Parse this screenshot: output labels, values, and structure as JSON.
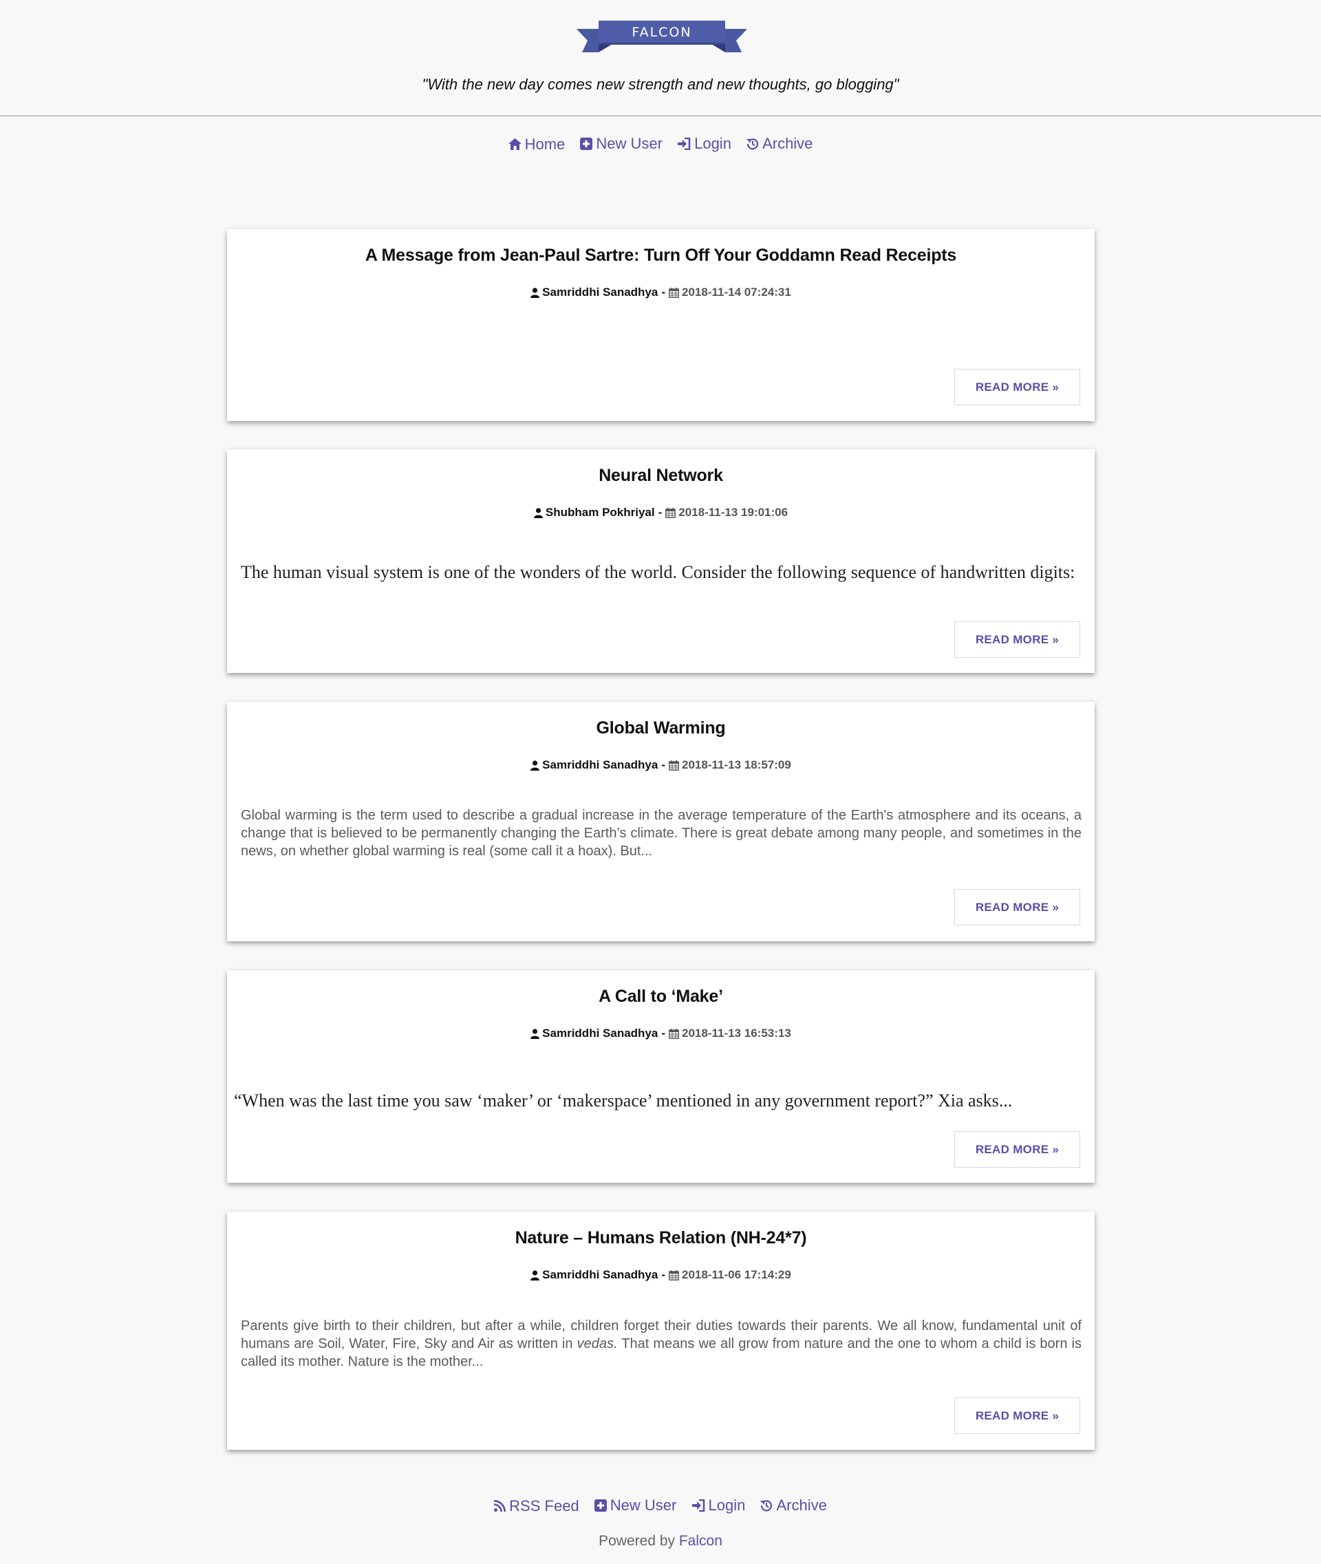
{
  "colors": {
    "accent": "#5a4ea8",
    "ribbon": "#4a58a0",
    "ribbon_dark": "#2f3a78",
    "page_bg": "#f8f8f8"
  },
  "header": {
    "logo_text": "FALCON",
    "tagline": "\"With the new day comes new strength and new thoughts, go blogging\""
  },
  "nav": {
    "items": [
      {
        "label": "Home",
        "icon": "home-icon"
      },
      {
        "label": "New User",
        "icon": "plus-square-icon"
      },
      {
        "label": "Login",
        "icon": "sign-in-icon"
      },
      {
        "label": "Archive",
        "icon": "history-icon"
      }
    ]
  },
  "posts": [
    {
      "title": "A Message from Jean-Paul Sartre: Turn Off Your Goddamn Read Receipts",
      "author": "Samriddhi Sanadhya",
      "date": "2018-11-14 07:24:31",
      "excerpt": "",
      "read_more": "READ MORE »"
    },
    {
      "title": "Neural Network",
      "author": "Shubham Pokhriyal",
      "date": "2018-11-13 19:01:06",
      "excerpt": "The human visual system is one of the wonders of the world. Consider the following sequence of handwritten digits:",
      "read_more": "READ MORE »"
    },
    {
      "title": "Global Warming",
      "author": "Samriddhi Sanadhya",
      "date": "2018-11-13 18:57:09",
      "excerpt": "Global warming is the term used to describe a gradual increase in the average temperature of the Earth's atmosphere and its oceans, a change that is believed to be permanently changing the Earth’s climate. There is great debate among many people, and sometimes in the news, on whether global warming is real (some call it a hoax). But...",
      "read_more": "READ MORE »"
    },
    {
      "title": "A Call to ‘Make’",
      "author": "Samriddhi Sanadhya",
      "date": "2018-11-13 16:53:13",
      "excerpt": "“When was the last time you saw ‘maker’ or ‘makerspace’ mentioned in any government report?” Xia asks...",
      "read_more": "READ MORE »"
    },
    {
      "title": "Nature – Humans Relation (NH-24*7)",
      "author": "Samriddhi Sanadhya",
      "date": "2018-11-06 17:14:29",
      "excerpt_before": "Parents give birth to their children, but after a while, children forget their duties towards their parents.  We all know, fundamental unit of humans are Soil, Water, Fire, Sky and Air as written in ",
      "excerpt_em": "vedas.",
      "excerpt_after": " That means we all grow from nature and the one to whom a child is born is called its mother. Nature is the mother...",
      "read_more": "READ MORE »"
    }
  ],
  "footer": {
    "items": [
      {
        "label": "RSS Feed",
        "icon": "rss-icon"
      },
      {
        "label": "New User",
        "icon": "plus-square-icon"
      },
      {
        "label": "Login",
        "icon": "sign-in-icon"
      },
      {
        "label": "Archive",
        "icon": "history-icon"
      }
    ],
    "powered_prefix": "Powered by",
    "powered_link": "Falcon"
  }
}
